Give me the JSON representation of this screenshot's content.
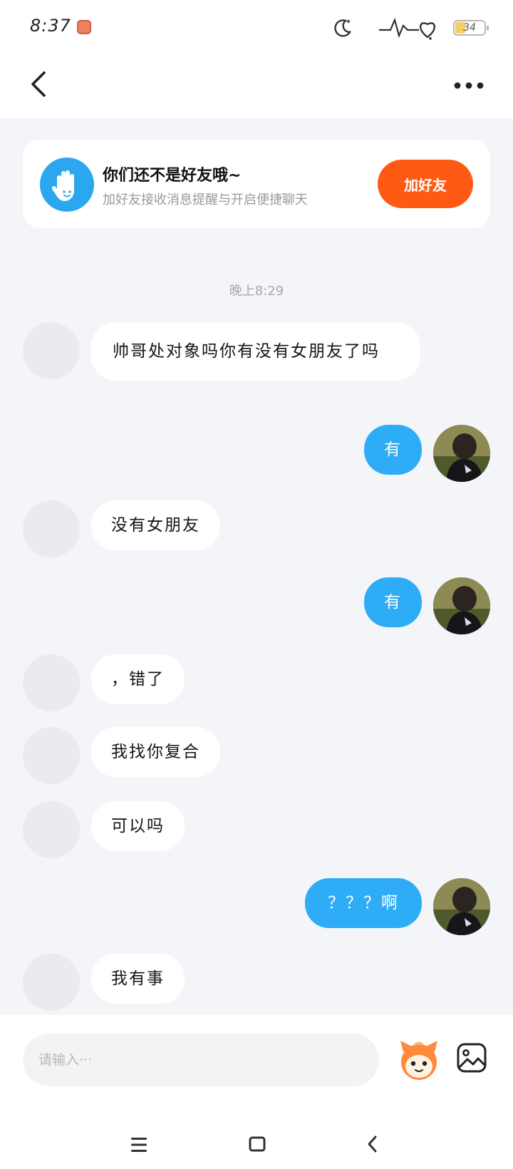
{
  "status_bar": {
    "time": "8:37",
    "battery": "34",
    "battery_level": 0.34,
    "icons": [
      "app-notification-icon",
      "moon-icon",
      "heartbeat-icon",
      "battery-icon"
    ]
  },
  "header": {
    "back_icon": "chevron-left-icon",
    "more_icon": "more-dots-icon"
  },
  "friend_card": {
    "title": "你们还不是好友哦~",
    "subtitle": "加好友接收消息提醒与开启便捷聊天",
    "button_label": "加好友",
    "icon": "waving-hand-icon"
  },
  "timestamp": "晚上8:29",
  "messages": [
    {
      "side": "in",
      "text": "帅哥处对象吗你有没有女朋友了吗"
    },
    {
      "side": "out",
      "text": "有"
    },
    {
      "side": "in",
      "text": "没有女朋友"
    },
    {
      "side": "out",
      "text": "有"
    },
    {
      "side": "in",
      "text": "，错了"
    },
    {
      "side": "in",
      "text": "我找你复合"
    },
    {
      "side": "in",
      "text": "可以吗"
    },
    {
      "side": "out",
      "text": "？？？啊"
    },
    {
      "side": "in",
      "text": "我有事"
    }
  ],
  "input": {
    "placeholder": "请输入···",
    "value": ""
  },
  "colors": {
    "accent_blue": "#2eacf5",
    "add_button_orange": "#ff5a14",
    "background": "#f3f5f8"
  },
  "system_nav": [
    "menu-icon",
    "home-square-icon",
    "back-arrow-icon"
  ]
}
